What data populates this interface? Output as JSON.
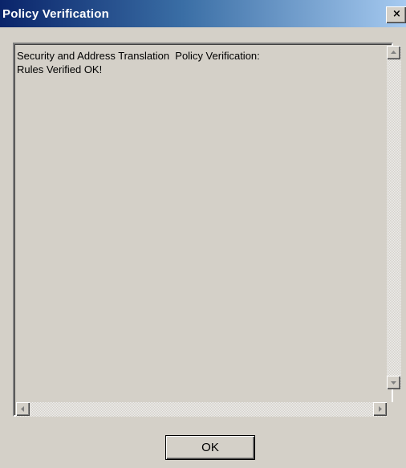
{
  "window": {
    "title": "Policy Verification",
    "close_label": "×"
  },
  "message": {
    "lines": [
      "Security and Address Translation  Policy Verification:",
      "Rules Verified OK!"
    ]
  },
  "buttons": {
    "ok_label": "OK"
  },
  "scrollbars": {
    "vertical_arrow_up_icon": "arrow-up-icon",
    "vertical_arrow_down_icon": "arrow-down-icon",
    "horizontal_arrow_left_icon": "arrow-left-icon",
    "horizontal_arrow_right_icon": "arrow-right-icon"
  },
  "colors": {
    "title_bar_start": "#0a246a",
    "title_bar_end": "#a6caf0",
    "face": "#d4d0c8"
  }
}
